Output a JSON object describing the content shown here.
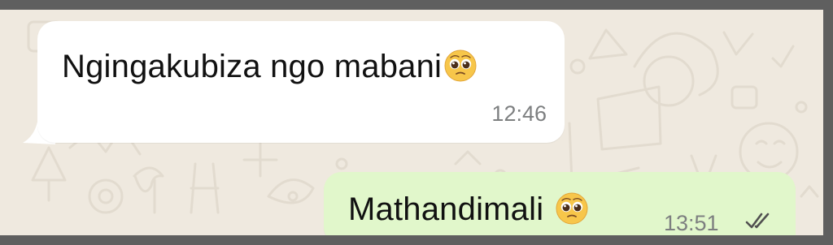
{
  "messages": [
    {
      "direction": "incoming",
      "text": "Ngingakubiza ngo mabani",
      "emoji": "pleading-face",
      "time": "12:46"
    },
    {
      "direction": "outgoing",
      "text": "Mathandimali",
      "emoji": "pleading-face",
      "time": "13:51",
      "status": "delivered-double-check"
    }
  ],
  "colors": {
    "chat_background": "#efe9df",
    "incoming_bubble": "#ffffff",
    "outgoing_bubble": "#e1f7cb",
    "timestamp": "#7d7f80",
    "frame": "#5f5f5f"
  }
}
